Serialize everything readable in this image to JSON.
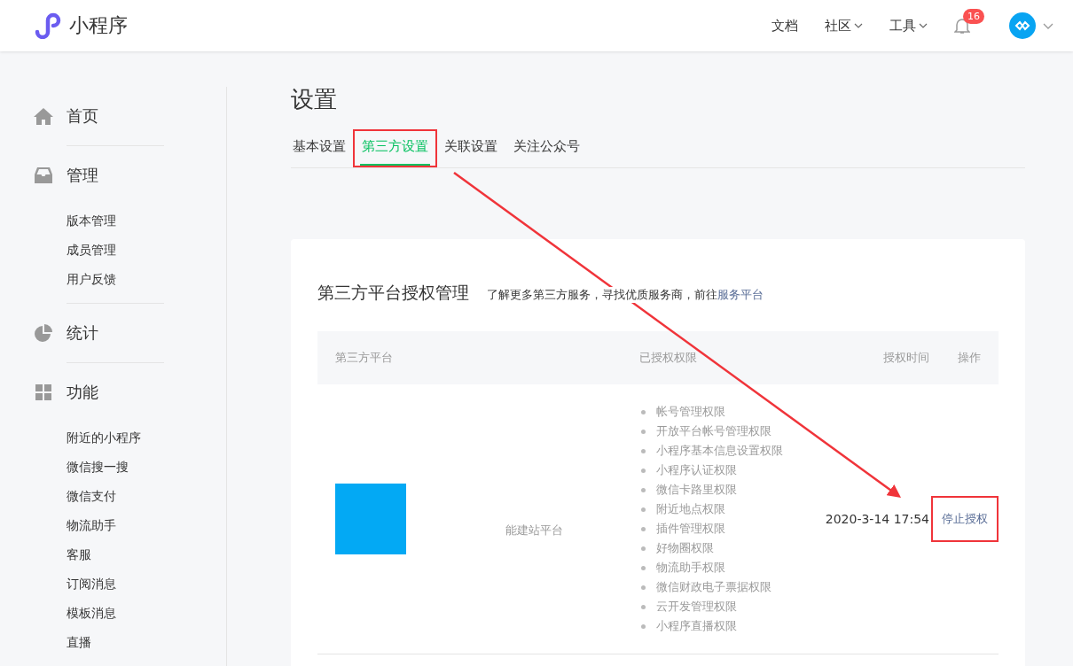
{
  "header": {
    "logo_text": "小程序",
    "nav": [
      {
        "label": "文档",
        "dropdown": false
      },
      {
        "label": "社区",
        "dropdown": true
      },
      {
        "label": "工具",
        "dropdown": true
      }
    ],
    "notification_count": "16"
  },
  "sidebar": {
    "sections": [
      {
        "label": "首页"
      },
      {
        "label": "管理",
        "children": [
          {
            "label": "版本管理"
          },
          {
            "label": "成员管理"
          },
          {
            "label": "用户反馈"
          }
        ]
      },
      {
        "label": "统计"
      },
      {
        "label": "功能",
        "children": [
          {
            "label": "附近的小程序"
          },
          {
            "label": "微信搜一搜"
          },
          {
            "label": "微信支付"
          },
          {
            "label": "物流助手"
          },
          {
            "label": "客服"
          },
          {
            "label": "订阅消息"
          },
          {
            "label": "模板消息"
          },
          {
            "label": "直播"
          }
        ]
      }
    ]
  },
  "page": {
    "title": "设置",
    "tabs": [
      {
        "label": "基本设置",
        "selected": false,
        "highlighted": false
      },
      {
        "label": "第三方设置",
        "selected": true,
        "highlighted": true
      },
      {
        "label": "关联设置",
        "selected": false,
        "highlighted": false
      },
      {
        "label": "关注公众号",
        "selected": false,
        "highlighted": false
      }
    ]
  },
  "card": {
    "title": "第三方平台授权管理",
    "hint": "了解更多第三方服务，寻找优质服务商，前往",
    "hint_link": "服务平台",
    "table": {
      "columns": [
        "第三方平台",
        "已授权权限",
        "授权时间",
        "操作"
      ],
      "rows": [
        {
          "name": "能建站平台",
          "permissions": [
            "帐号管理权限",
            "开放平台帐号管理权限",
            "小程序基本信息设置权限",
            "小程序认证权限",
            "微信卡路里权限",
            "附近地点权限",
            "插件管理权限",
            "好物圈权限",
            "物流助手权限",
            "微信财政电子票据权限",
            "云开发管理权限",
            "小程序直播权限"
          ],
          "time": "2020-3-14 17:54",
          "action": "停止授权",
          "action_highlighted": true
        }
      ]
    }
  }
}
